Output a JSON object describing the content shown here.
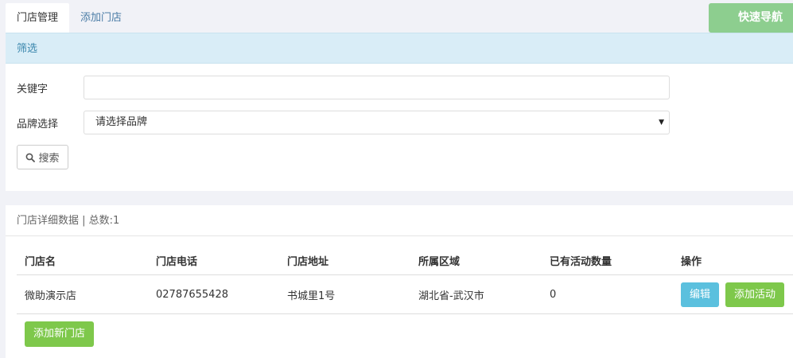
{
  "tabs": [
    {
      "label": "门店管理",
      "active": true
    },
    {
      "label": "添加门店",
      "active": false
    }
  ],
  "quick_nav_label": "快速导航",
  "filter": {
    "heading": "筛选",
    "keyword_label": "关键字",
    "keyword_value": "",
    "brand_label": "品牌选择",
    "brand_selected": "请选择品牌",
    "search_label": "搜索"
  },
  "data_panel": {
    "heading": "门店详细数据 | 总数:1",
    "columns": [
      "门店名",
      "门店电话",
      "门店地址",
      "所属区域",
      "已有活动数量",
      "操作"
    ],
    "rows": [
      {
        "name": "微助演示店",
        "phone": "02787655428",
        "address": "书城里1号",
        "region": "湖北省-武汉市",
        "activity_count": "0",
        "edit_label": "编辑",
        "add_activity_label": "添加活动"
      }
    ],
    "add_store_label": "添加新门店"
  },
  "colors": {
    "page_bg": "#f1f2f7",
    "heading_bg": "#d9edf7",
    "heading_text": "#3a87ad",
    "quick_nav": "#8dce8f",
    "btn_info": "#5bc0de",
    "btn_success": "#7ec84b"
  }
}
